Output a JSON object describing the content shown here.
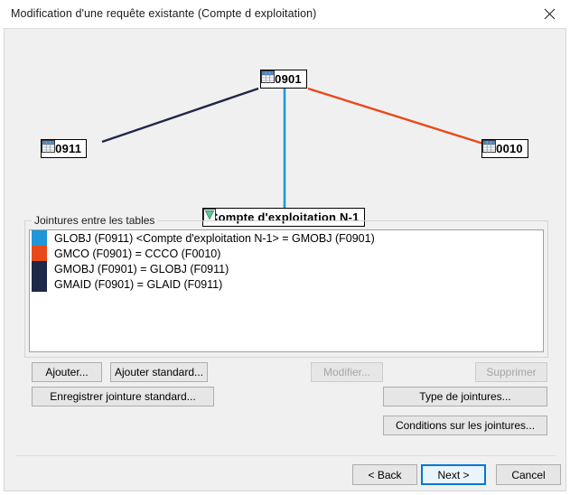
{
  "window": {
    "title": "Modification d'une requête existante (Compte d exploitation)",
    "close_icon": "close-icon"
  },
  "diagram": {
    "nodes": [
      {
        "id": "f0901",
        "label": "F0901",
        "icon": "table-icon"
      },
      {
        "id": "f0911",
        "label": "F0911",
        "icon": "table-icon"
      },
      {
        "id": "f0010",
        "label": "F0010",
        "icon": "table-icon"
      },
      {
        "id": "view",
        "label": "Compte d'exploitation N-1",
        "icon": "view-filter-icon"
      }
    ],
    "edge_colors": {
      "navy": "#1e2847",
      "orange": "#e8491a",
      "cyan": "#2196d8"
    }
  },
  "joins_group": {
    "label": "Jointures entre les tables",
    "items": [
      {
        "color": "#2196d8",
        "text": "GLOBJ (F0911) <Compte d'exploitation N-1> = GMOBJ (F0901)"
      },
      {
        "color": "#e8491a",
        "text": "GMCO (F0901) = CCCO (F0010)"
      },
      {
        "color": "#1e2847",
        "text": "GMOBJ (F0901) = GLOBJ (F0911)"
      },
      {
        "color": "#1e2847",
        "text": "GMAID (F0901) = GLAID (F0911)"
      }
    ]
  },
  "actions": {
    "ajouter": "Ajouter...",
    "ajouter_standard": "Ajouter standard...",
    "modifier": "Modifier...",
    "supprimer": "Supprimer",
    "enregistrer_jointure_standard": "Enregistrer jointure standard...",
    "type_de_jointures": "Type de jointures...",
    "conditions_sur_les_jointures": "Conditions sur les jointures..."
  },
  "footer": {
    "back": "< Back",
    "next": "Next >",
    "cancel": "Cancel"
  }
}
